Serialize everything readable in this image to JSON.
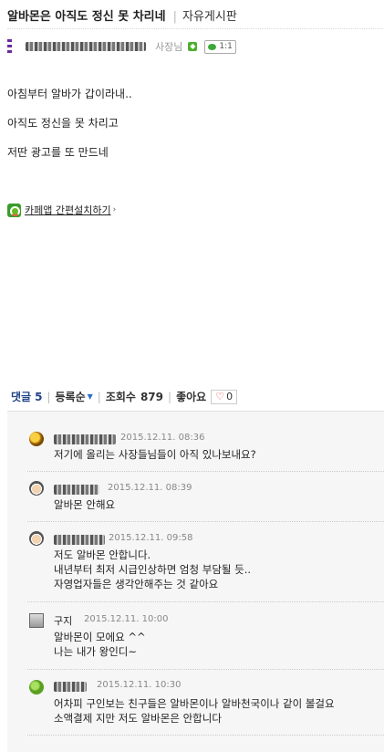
{
  "post": {
    "title": "알바몬은 아직도 정신 못 차리네",
    "board": "자유게시판",
    "author_grade": "사장님",
    "comment_count_chip": "1:1",
    "lines": [
      "아침부터 알바가 갑이라내..",
      "아직도 정신을 못 차리고",
      "저딴 광고를 또 만드네"
    ],
    "app_link": "카페앱 간편설치하기"
  },
  "stats": {
    "comment_label": "댓글",
    "comment_count": "5",
    "sort_label": "등록순",
    "view_label": "조회수",
    "view_count": "879",
    "like_label": "좋아요",
    "like_count": "0"
  },
  "comments": [
    {
      "date": "2015.12.11. 08:36",
      "lines": [
        "저기에 올리는 사장들님들이 아직 있나보내요?"
      ],
      "avatar": "gold-coin-icon"
    },
    {
      "date": "2015.12.11. 08:39",
      "lines": [
        "알바몬 안해요"
      ],
      "avatar": "face-icon"
    },
    {
      "date": "2015.12.11. 09:58",
      "lines": [
        "저도 알바몬 안합니다.",
        "내년부터 최저 시급인상하면 엄청 부담될 듯..",
        "자영업자들은 생각안해주는 것 같아요"
      ],
      "avatar": "face-icon"
    },
    {
      "nick": "구지",
      "date": "2015.12.11. 10:00",
      "lines": [
        "알바몬이 모에요 ^^",
        "나는 내가 왕인디~"
      ],
      "avatar": "calculator-icon"
    },
    {
      "date": "2015.12.11. 10:30",
      "lines": [
        "어차피 구인보는 친구들은 알바몬이나 알바천국이나 같이 볼걸요",
        "소액결제 지만 저도 알바몬은 안합니다"
      ],
      "avatar": "leaf-icon"
    }
  ],
  "colors": {
    "accent_blue": "#224488",
    "level_purple": "#6a2aa0",
    "heart_red": "#e04040"
  }
}
